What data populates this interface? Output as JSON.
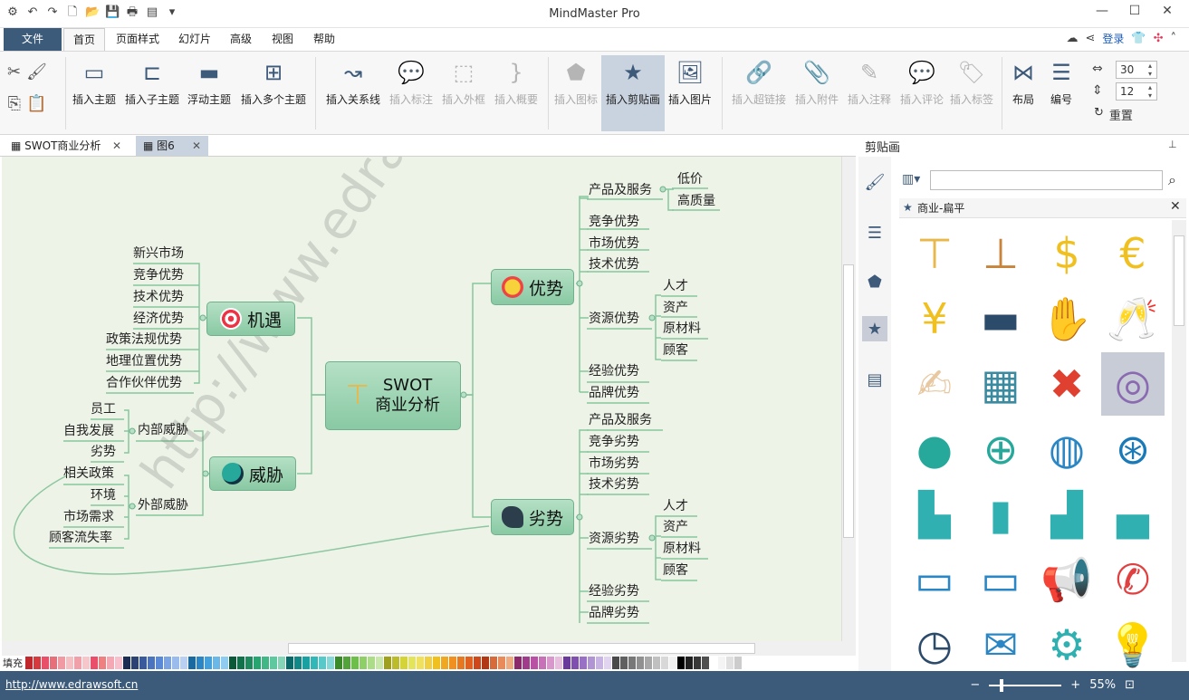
{
  "app": {
    "title": "MindMaster Pro"
  },
  "window_controls": [
    "—",
    "☐",
    "✕"
  ],
  "menu_tabs": [
    "文件",
    "首页",
    "页面样式",
    "幻灯片",
    "高级",
    "视图",
    "帮助"
  ],
  "menu_right": {
    "login": "登录"
  },
  "ribbon": {
    "insert_topic": "插入主题",
    "insert_subtopic": "插入子主题",
    "floating_topic": "浮动主题",
    "insert_multiple": "插入多个主题",
    "insert_relationship": "插入关系线",
    "insert_callout": "插入标注",
    "insert_boundary": "插入外框",
    "insert_summary": "插入概要",
    "insert_icon": "插入图标",
    "insert_clipart": "插入剪贴画",
    "insert_image": "插入图片",
    "insert_hyperlink": "插入超链接",
    "insert_attachment": "插入附件",
    "insert_note": "插入注释",
    "insert_comment": "插入评论",
    "insert_tag": "插入标签",
    "layout": "布局",
    "numbering": "编号",
    "spin_width": "30",
    "spin_height": "12",
    "reset": "重置"
  },
  "doc_tabs": [
    {
      "label": "SWOT商业分析"
    },
    {
      "label": "图6"
    }
  ],
  "mindmap": {
    "center": "SWOT\n商业分析",
    "strengths": {
      "label": "优势",
      "children": [
        "产品及服务",
        "竞争优势",
        "市场优势",
        "技术优势",
        "资源优势",
        "经验优势",
        "品牌优势"
      ],
      "product_children": [
        "低价",
        "高质量"
      ],
      "resource_children": [
        "人才",
        "资产",
        "原材料",
        "顾客"
      ]
    },
    "weaknesses": {
      "label": "劣势",
      "children": [
        "产品及服务",
        "竞争劣势",
        "市场劣势",
        "技术劣势",
        "资源劣势",
        "经验劣势",
        "品牌劣势"
      ],
      "resource_children": [
        "人才",
        "资产",
        "原材料",
        "顾客"
      ]
    },
    "opportunities": {
      "label": "机遇",
      "children": [
        "新兴市场",
        "竞争优势",
        "技术优势",
        "经济优势",
        "政策法规优势",
        "地理位置优势",
        "合作伙伴优势"
      ]
    },
    "threats": {
      "label": "威胁",
      "internal": "内部威胁",
      "internal_children": [
        "员工",
        "自我发展",
        "劣势"
      ],
      "external": "外部威胁",
      "external_children": [
        "相关政策",
        "环境",
        "市场需求",
        "顾客流失率"
      ]
    }
  },
  "watermark": "http://www.edrawsoft.cn/",
  "palette": {
    "fill_label": "填充"
  },
  "status": {
    "url": "http://www.edrawsoft.cn",
    "zoom": "55%"
  },
  "panel": {
    "title": "剪贴画",
    "search_placeholder": "",
    "library": "商业-扁平",
    "cliparts": [
      "signpost-icon",
      "direction-sign-icon",
      "dollar-icon",
      "euro-icon",
      "yen-icon",
      "credit-card-icon",
      "handshake-icon",
      "toast-icon",
      "agreement-icon",
      "blocks-icon",
      "puzzle-cross-icon",
      "target-icon",
      "globe-africa-icon",
      "globe-search-icon",
      "globe-blue-icon",
      "globe-grid-icon",
      "city-icon",
      "skyscraper-icon",
      "buildings-icon",
      "factory-icon",
      "briefcase-icon",
      "briefcase-blue-icon",
      "megaphone-icon",
      "phone-call-icon",
      "clock-icon",
      "email-icon",
      "head-gears-icon",
      "head-idea-icon"
    ]
  }
}
